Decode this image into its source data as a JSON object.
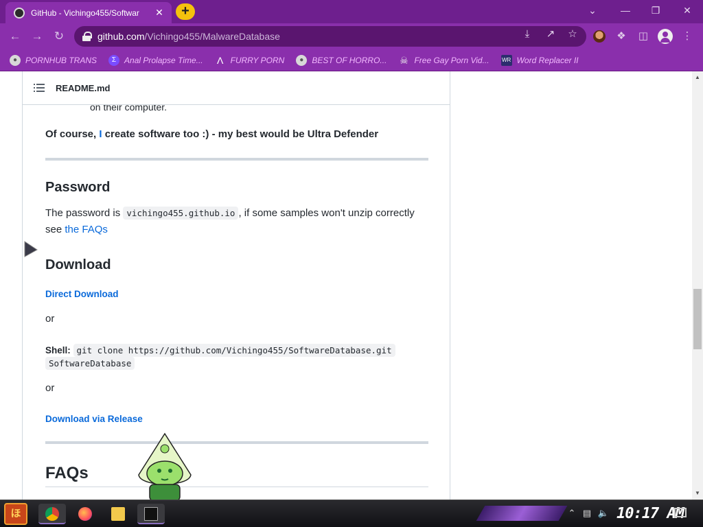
{
  "browser": {
    "tab_title": "GitHub - Vichingo455/Softwar",
    "tab_close": "✕",
    "new_tab": "+",
    "url_host": "github.com",
    "url_path": "/Vichingo455/MalwareDatabase",
    "window": {
      "minimize": "—",
      "restore": "❐",
      "close": "✕",
      "tabsearch": "⌄"
    }
  },
  "bookmarks": [
    {
      "label": "PORNHUB TRANS",
      "icon": "globe-icon"
    },
    {
      "label": "Anal Prolapse Time...",
      "icon": "sigma-icon"
    },
    {
      "label": "FURRY PORN",
      "icon": "lambda-icon"
    },
    {
      "label": "BEST OF HORRO...",
      "icon": "globe-icon"
    },
    {
      "label": "Free Gay Porn Vid...",
      "icon": "skull-icon"
    },
    {
      "label": "Word Replacer II",
      "icon": "wr-icon"
    }
  ],
  "readme": {
    "title": "README.md",
    "trailing_text": "on their computer.",
    "bold_line_pre": "Of course, ",
    "bold_line_i": "I",
    "bold_line_post": " create software too :) - my best would be Ultra Defender",
    "password_heading": "Password",
    "password_pre": "The password is ",
    "password_code": "vichingo455.github.io",
    "password_post": ", if some samples won't unzip correctly",
    "password_see": "see ",
    "faqs_link": "the FAQs",
    "download_heading": "Download",
    "direct_download": "Direct Download",
    "or1": "or",
    "shell_label": "Shell:",
    "shell_code_1": "git clone https://github.com/Vichingo455/SoftwareDatabase.git",
    "shell_code_2": "SoftwareDatabase",
    "or2": "or",
    "release_download": "Download via Release",
    "faqs_heading": "FAQs"
  },
  "taskbar": {
    "start_label": "ほ",
    "clock": "10:17 AM",
    "apps": [
      {
        "name": "chrome",
        "color": "#dd4b39"
      },
      {
        "name": "firefox",
        "color": "#ff7139"
      },
      {
        "name": "file-explorer",
        "color": "#f2c94c"
      },
      {
        "name": "terminal",
        "color": "#111111"
      }
    ]
  },
  "colors": {
    "accent": "#8a2fac",
    "link": "#0969da"
  }
}
